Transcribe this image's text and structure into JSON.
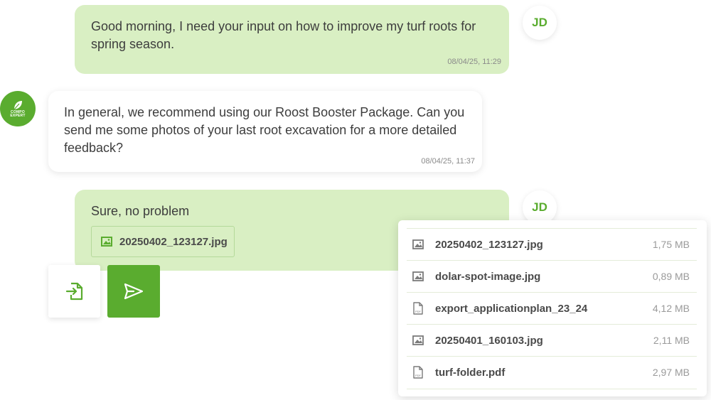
{
  "user": {
    "initials": "JD"
  },
  "brand": {
    "logo_line1": "COMPO",
    "logo_line2": "EXPERT"
  },
  "messages": [
    {
      "sender": "user",
      "text_line1": "Good morning, I need your input on how to improve my turf roots for",
      "text_line2": "spring season.",
      "time": "08/04/25, 11:29"
    },
    {
      "sender": "bot",
      "text_line1": "In general, we recommend using our Roost Booster Package. Can you",
      "text_line2": "send me some photos of your last root excavation for a more detailed",
      "text_line3": "feedback?",
      "time": "08/04/25, 11:37"
    },
    {
      "sender": "user",
      "text_line1": "Sure, no problem",
      "attachment": "20250402_123127.jpg"
    }
  ],
  "actions": {
    "attach_icon": "file-import-icon",
    "send_icon": "send-icon"
  },
  "file_picker": {
    "files": [
      {
        "name": "20250402_123127.jpg",
        "size": "1,75 MB",
        "icon": "image-icon"
      },
      {
        "name": "dolar-spot-image.jpg",
        "size": "0,89 MB",
        "icon": "image-icon"
      },
      {
        "name": "export_applicationplan_23_24",
        "size": "4,12 MB",
        "icon": "pdf-icon"
      },
      {
        "name": "20250401_160103.jpg",
        "size": "2,11 MB",
        "icon": "image-icon"
      },
      {
        "name": "turf-folder.pdf",
        "size": "2,97 MB",
        "icon": "pdf-icon"
      }
    ]
  },
  "colors": {
    "accent": "#5aac2f",
    "user_bubble": "#d9efc3"
  }
}
